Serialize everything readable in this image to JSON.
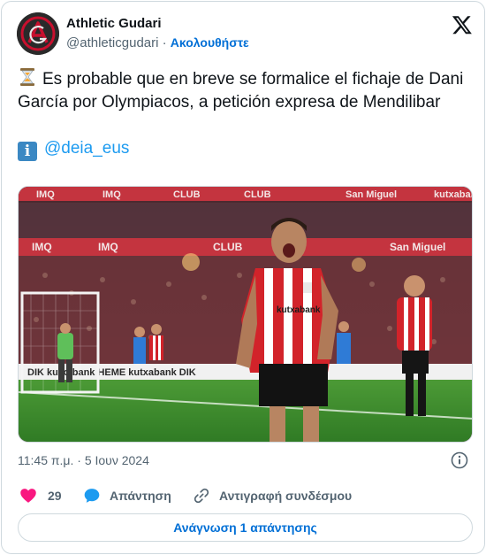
{
  "author": {
    "display_name": "Athletic Gudari",
    "handle": "@athleticgudari",
    "separator": "·",
    "follow_label": "Ακολουθήστε"
  },
  "tweet": {
    "line1": "Es probable que en breve se formalice el fichaje de Dani García por Olympiacos, a petición expresa de Mendilibar",
    "mention": "@deia_eus"
  },
  "media": {
    "banner_words": [
      "IMQ",
      "IMQ",
      "IMQ",
      "IMQ",
      "CLUB",
      "CLUB",
      "CLUB",
      "San Miguel",
      "San Miguel",
      "kutxabank"
    ],
    "jersey_sponsor": "kutxabank",
    "lower_board": "DIK  kutxabank    HEME    kutxabank    DIK",
    "brand_colors": {
      "stripe_red": "#d2232a",
      "stripe_white": "#ffffff",
      "pitch": "#3f8f2f"
    }
  },
  "footer": {
    "timestamp": "11:45 π.μ. · 5 Ιουν 2024"
  },
  "actions": {
    "like_count": "29",
    "reply_label": "Απάντηση",
    "copy_link_label": "Αντιγραφή συνδέσμου"
  },
  "read_replies_label": "Ανάγνωση 1 απάντησης",
  "colors": {
    "link_blue": "#006fd6",
    "mention_blue": "#1d9bf0",
    "like_pink": "#f91880",
    "muted": "#536471",
    "border": "#cfd9de"
  },
  "icons": [
    "athletic-gudari-logo",
    "x-logo-icon",
    "hourglass-icon",
    "info-emoji-icon",
    "info-circle-icon",
    "heart-icon",
    "reply-bubble-icon",
    "link-icon"
  ]
}
